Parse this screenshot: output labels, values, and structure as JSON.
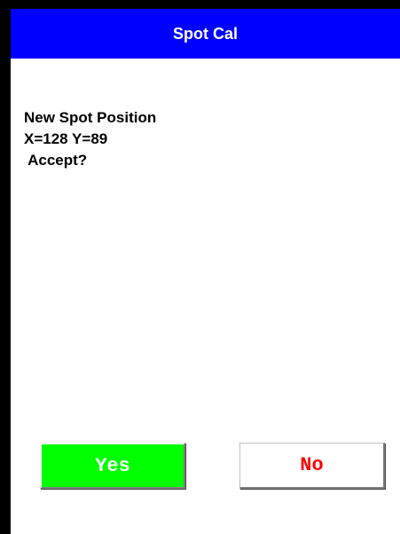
{
  "dialog": {
    "title": "Spot Cal",
    "message": {
      "line1": "New Spot Position",
      "line2": "X=128 Y=89",
      "line3": " Accept?"
    },
    "buttons": {
      "yes_label": "Yes",
      "no_label": "No"
    }
  },
  "colors": {
    "title_bar": "#0000ff",
    "title_text": "#ffffff",
    "yes_button_bg": "#00ff00",
    "yes_button_text": "#ffffff",
    "no_button_bg": "#ffffff",
    "no_button_text": "#ff0000",
    "frame": "#000000"
  }
}
